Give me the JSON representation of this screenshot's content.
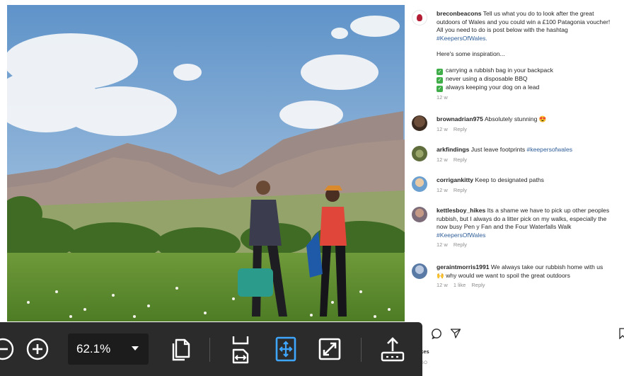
{
  "post": {
    "username": "breconbeacons",
    "caption_lines": [
      "Tell us what you do to look after the great",
      "outdoors of Wales and you could win a £100 Patagonia voucher!",
      "All you need to do is post below with the hashtag"
    ],
    "hashtag": "#KeepersOfWales.",
    "inspiration": "Here's some inspiration...",
    "checklist": [
      "carrying a rubbish bag in your backpack",
      "never using a disposable BBQ",
      "always keeping your dog on a lead"
    ],
    "age": "12 w"
  },
  "comments": [
    {
      "username": "brownadrian975",
      "text": "Absolutely stunning",
      "emoji": "😍",
      "age": "12 w",
      "reply": "Reply"
    },
    {
      "username": "arkfindings",
      "text": "Just leave footprints",
      "tag": "#keepersofwales",
      "age": "12 w",
      "reply": "Reply"
    },
    {
      "username": "corrigankitty",
      "text": "Keep to designated paths",
      "age": "12 w",
      "reply": "Reply"
    },
    {
      "username": "kettlesboy_hikes",
      "text_lines": [
        "Its a shame we have to pick up other peoples",
        "rubbish, but I always do a litter pick on my walks, especially the",
        "now busy Pen y Fan and the Four Waterfalls Walk"
      ],
      "tag": "#KeepersOfWales",
      "age": "12 w",
      "reply": "Reply"
    },
    {
      "username": "geraintmorris1991",
      "text_lines": [
        "We always take our rubbish home with us",
        "why would we want to spoil the great outdoors"
      ],
      "emoji": "🙌",
      "age": "12 w",
      "likes": "1 like",
      "reply": "Reply"
    }
  ],
  "actions": {
    "icons": [
      "comment-icon",
      "share-icon",
      "bookmark-icon"
    ]
  },
  "likes_partial": "likes",
  "age_partial": "AGO",
  "toolbar": {
    "zoom_value": "62.1%",
    "icons": [
      "zoom-out-icon",
      "zoom-in-icon",
      "copy-icon",
      "fit-page-icon",
      "fit-width-icon",
      "fullscreen-icon",
      "share-upload-icon"
    ],
    "accent": "#3ea6ff"
  }
}
